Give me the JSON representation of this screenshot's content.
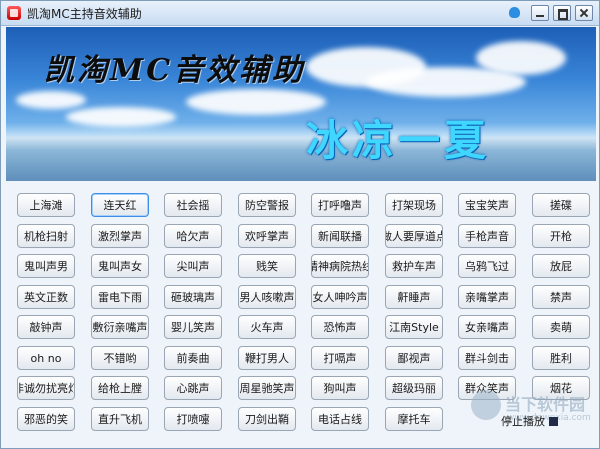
{
  "window": {
    "title": "凯淘MC主持音效辅助"
  },
  "banner": {
    "title": "凯淘MC音效辅助",
    "subtitle": "冰凉一夏"
  },
  "sound_buttons": [
    [
      "上海滩",
      "连天红",
      "社会摇",
      "防空警报",
      "打呼噜声",
      "打架现场",
      "宝宝笑声",
      "搓碟"
    ],
    [
      "机枪扫射",
      "激烈掌声",
      "哈欠声",
      "欢呼掌声",
      "新闻联播",
      "做人要厚道点",
      "手枪声音",
      "开枪"
    ],
    [
      "鬼叫声男",
      "鬼叫声女",
      "尖叫声",
      "贱笑",
      "精神病院热线",
      "救护车声",
      "乌鸦飞过",
      "放屁"
    ],
    [
      "英文正数",
      "雷电下雨",
      "砸玻璃声",
      "男人咳嗽声",
      "女人呻吟声",
      "鼾睡声",
      "亲嘴掌声",
      "禁声"
    ],
    [
      "敲钟声",
      "敷衍亲嘴声",
      "婴儿笑声",
      "火车声",
      "恐怖声",
      "江南Style",
      "女亲嘴声",
      "卖萌"
    ],
    [
      "oh no",
      "不错哟",
      "前奏曲",
      "鞭打男人",
      "打嗝声",
      "鄙视声",
      "群斗剑击",
      "胜利"
    ],
    [
      "非诚勿扰亮灯",
      "给枪上膛",
      "心跳声",
      "周星驰笑声",
      "狗叫声",
      "超级玛丽",
      "群众笑声",
      "烟花"
    ],
    [
      "邪恶的笑",
      "直升飞机",
      "打喷嚏",
      "刀剑出鞘",
      "电话占线",
      "摩托车"
    ]
  ],
  "focused_button": "连天红",
  "stop": {
    "label": "停止播放"
  },
  "watermark": {
    "text": "当下软件园",
    "url": "www.downxia.com"
  },
  "colors": {
    "banner_subtitle": "#3fd6ff",
    "focus_border": "#3d8ee6",
    "stop_icon": "#1f2b48"
  }
}
